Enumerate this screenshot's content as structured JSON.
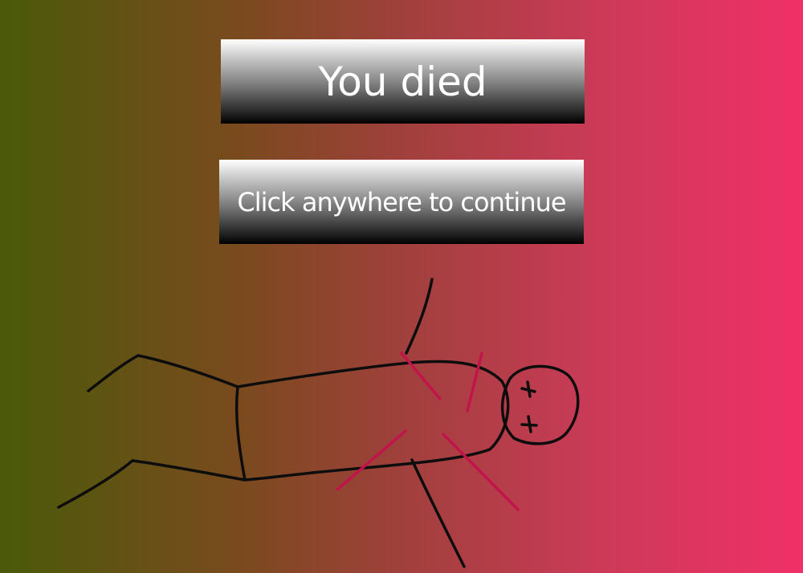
{
  "death_screen": {
    "title": "You died",
    "prompt": "Click anywhere to continue"
  },
  "figure": {
    "description_icon": "dead-stick-figure",
    "outline_color": "#0d0d0d",
    "wound_color": "#c0144a"
  }
}
